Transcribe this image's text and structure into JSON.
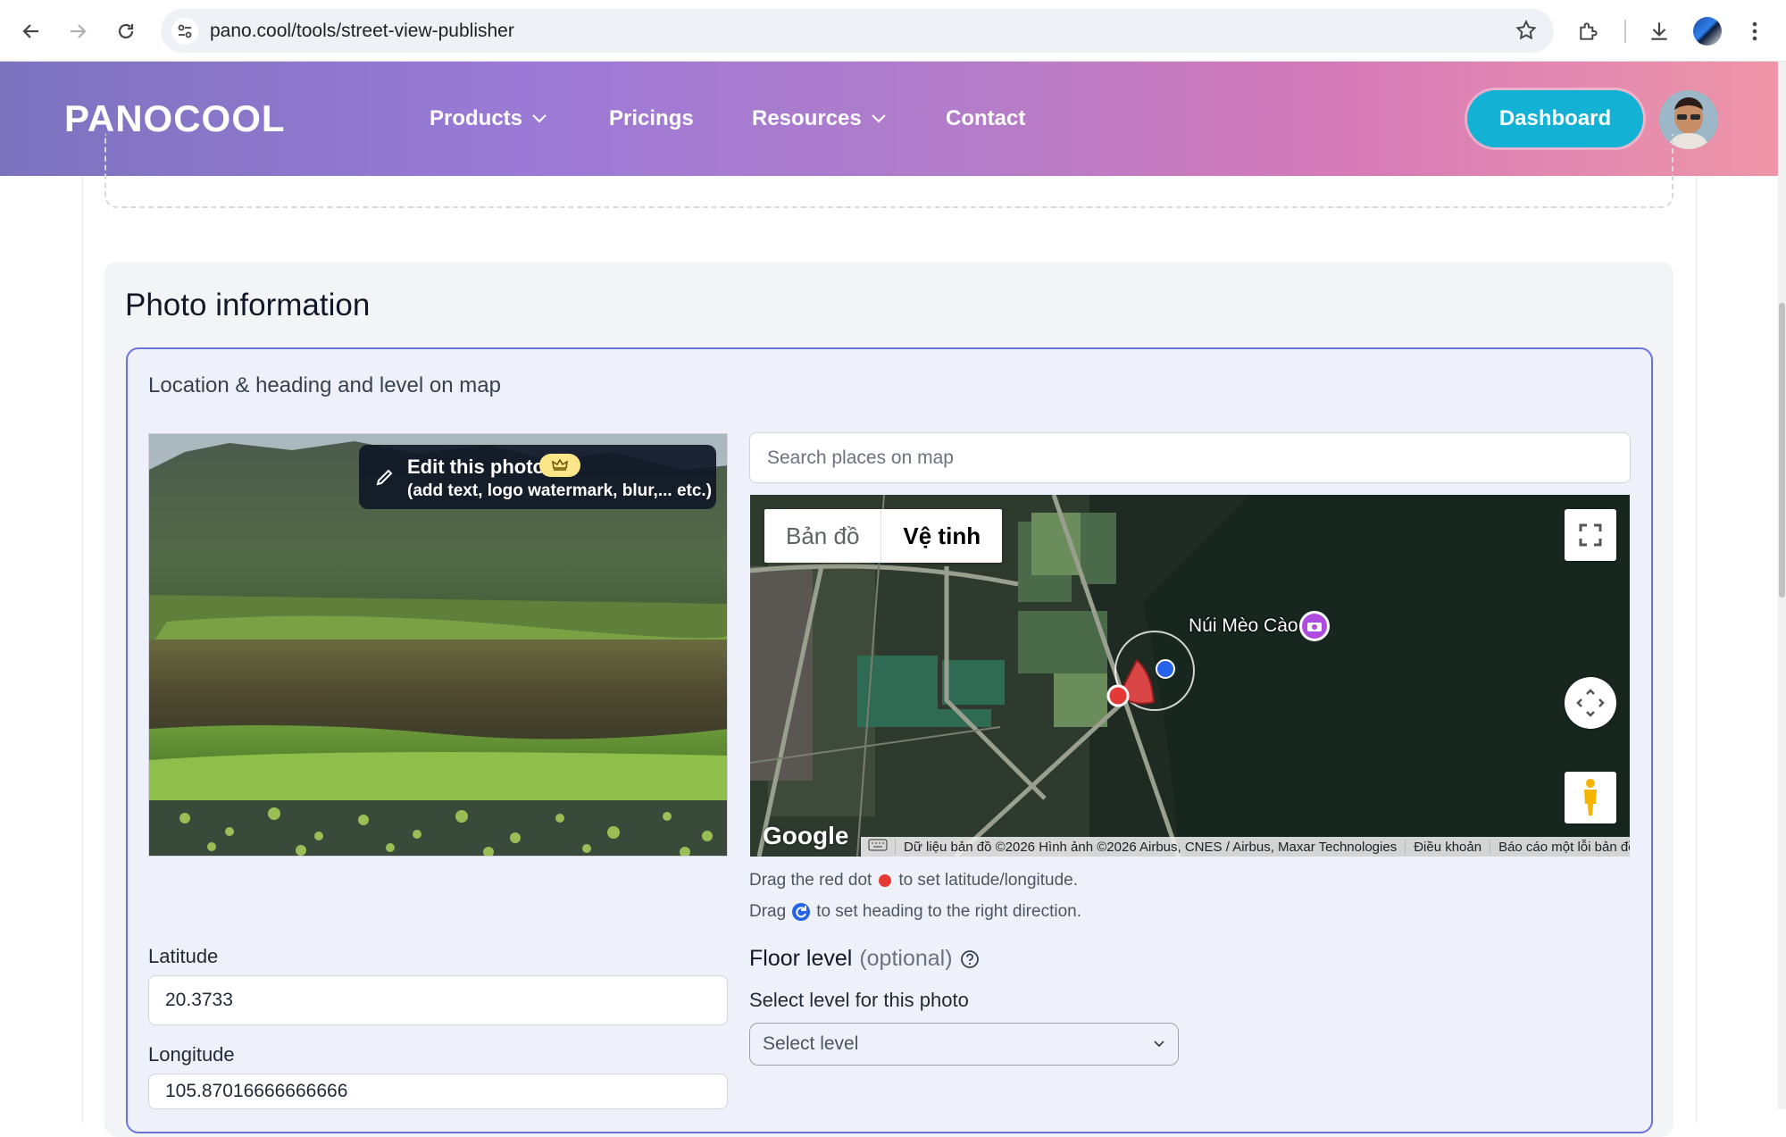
{
  "browser": {
    "url": "pano.cool/tools/street-view-publisher"
  },
  "header": {
    "logo": "PANOCOOL",
    "nav": [
      {
        "label": "Products",
        "has_dropdown": true
      },
      {
        "label": "Pricings",
        "has_dropdown": false
      },
      {
        "label": "Resources",
        "has_dropdown": true
      },
      {
        "label": "Contact",
        "has_dropdown": false
      }
    ],
    "dashboard_label": "Dashboard"
  },
  "section": {
    "title": "Photo information",
    "panel_title": "Location & heading and level on map"
  },
  "photo": {
    "edit_title": "Edit this photo",
    "edit_subtitle": "(add text, logo watermark, blur,... etc.)",
    "premium_icon": "crown-icon"
  },
  "map": {
    "search_placeholder": "Search places on map",
    "type_map": "Bản đồ",
    "type_satellite": "Vệ tinh",
    "active_type": "satellite",
    "place_label": "Núi Mèo Cào",
    "google": "Google",
    "attribution": "Dữ liệu bản đồ ©2026 Hình ảnh ©2026 Airbus, CNES / Airbus, Maxar Technologies",
    "terms": "Điều khoản",
    "report": "Báo cáo một lỗi bản đồ"
  },
  "hints": {
    "drag_dot_prefix": "Drag the red dot",
    "drag_dot_suffix": "to set latitude/longitude.",
    "drag_heading_prefix": "Drag",
    "drag_heading_suffix": "to set heading to the right direction."
  },
  "location": {
    "latitude_label": "Latitude",
    "latitude_value": "20.3733",
    "longitude_label": "Longitude",
    "longitude_value": "105.87016666666666"
  },
  "floor": {
    "title": "Floor level",
    "optional": "(optional)",
    "select_label": "Select level for this photo",
    "select_value": "Select level"
  },
  "colors": {
    "accent": "#13b1d4",
    "panel_border": "#6c72dc",
    "marker": "#e53935"
  }
}
